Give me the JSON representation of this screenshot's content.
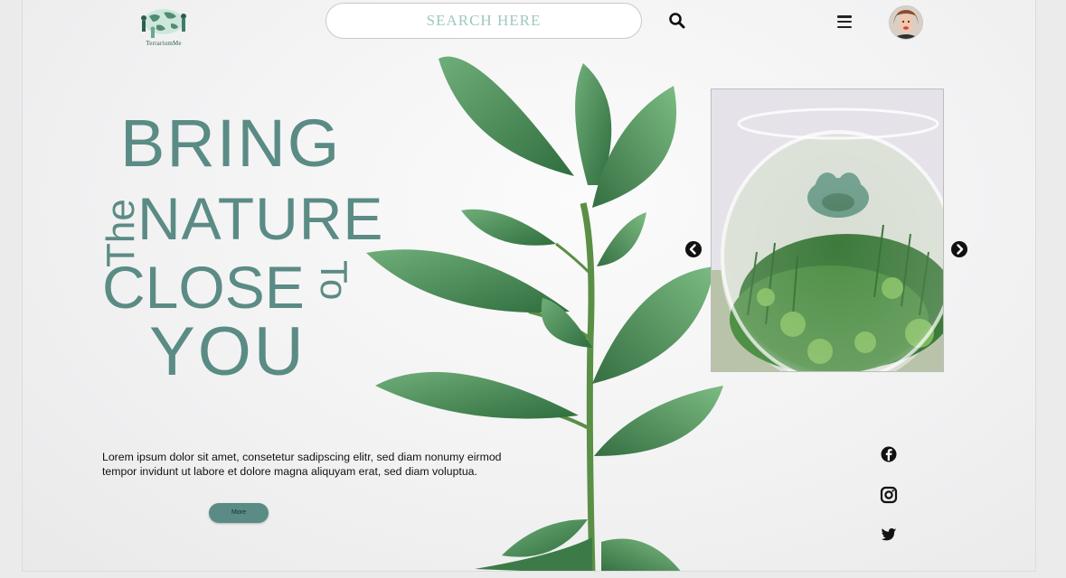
{
  "header": {
    "logo_text": "TerrariumMe",
    "search_placeholder": "SEARCH HERE"
  },
  "hero": {
    "line_bring": "BRING",
    "line_nature": "NATURE",
    "line_close": "CLOSE",
    "line_you": "YOU",
    "side_the": "The",
    "side_to": "To",
    "description": "Lorem ipsum dolor sit amet, consetetur sadipscing elitr, sed diam nonumy eirmod tempor invidunt ut labore et dolore magna aliquyam erat, sed diam voluptua.",
    "more_label": "More"
  },
  "icons": {
    "search": "search-icon",
    "menu": "hamburger-menu-icon",
    "prev": "chevron-left-icon",
    "next": "chevron-right-icon",
    "facebook": "facebook-icon",
    "instagram": "instagram-icon",
    "twitter": "twitter-icon"
  },
  "colors": {
    "accent": "#5b8b85",
    "search_text": "#9fc8c1",
    "background": "#f2f2f3"
  }
}
